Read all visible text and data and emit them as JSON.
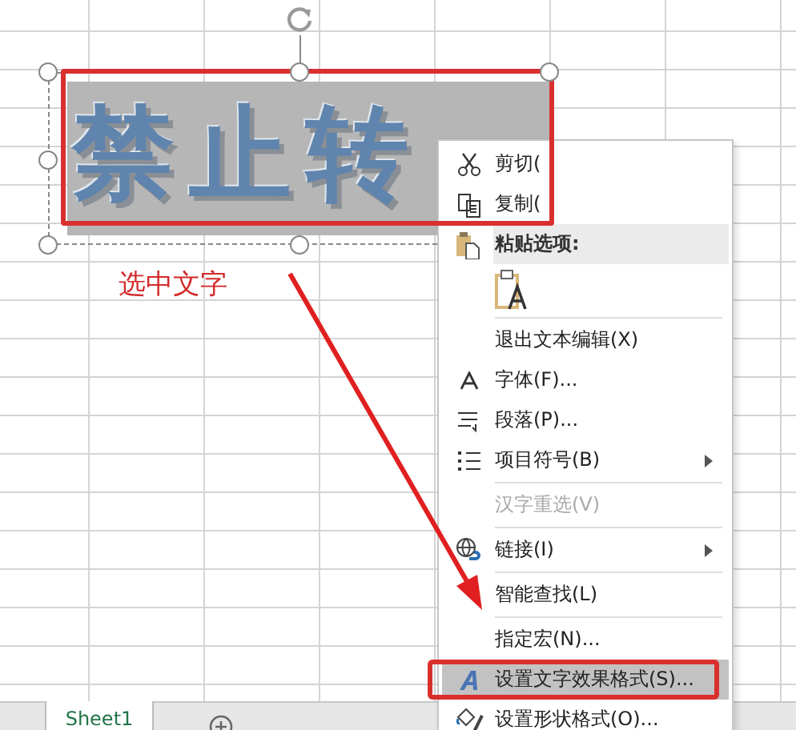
{
  "text_box": {
    "text": "禁止转",
    "selected": true
  },
  "annotation": "选中文字",
  "context_menu": [
    {
      "kind": "item",
      "label": "剪切(",
      "disabled": false,
      "selected": false,
      "submenu": false
    },
    {
      "kind": "item",
      "label": "复制(",
      "disabled": false,
      "selected": false,
      "submenu": false
    },
    {
      "kind": "header",
      "label": "粘贴选项:"
    },
    {
      "kind": "paste"
    },
    {
      "kind": "separator"
    },
    {
      "kind": "item",
      "label": "退出文本编辑(X)",
      "disabled": false,
      "selected": false,
      "submenu": false
    },
    {
      "kind": "item",
      "label": "字体(F)...",
      "disabled": false,
      "selected": false,
      "submenu": false
    },
    {
      "kind": "item",
      "label": "段落(P)...",
      "disabled": false,
      "selected": false,
      "submenu": false
    },
    {
      "kind": "item",
      "label": "项目符号(B)",
      "disabled": false,
      "selected": false,
      "submenu": true
    },
    {
      "kind": "separator"
    },
    {
      "kind": "item",
      "label": "汉字重选(V)",
      "disabled": true,
      "selected": false,
      "submenu": false
    },
    {
      "kind": "separator"
    },
    {
      "kind": "item",
      "label": "链接(I)",
      "disabled": false,
      "selected": false,
      "submenu": true
    },
    {
      "kind": "separator"
    },
    {
      "kind": "item",
      "label": "智能查找(L)",
      "disabled": false,
      "selected": false,
      "submenu": false
    },
    {
      "kind": "separator"
    },
    {
      "kind": "item",
      "label": "指定宏(N)...",
      "disabled": false,
      "selected": false,
      "submenu": false
    },
    {
      "kind": "item",
      "label": "设置文字效果格式(S)...",
      "disabled": false,
      "selected": true,
      "submenu": false
    },
    {
      "kind": "item",
      "label": "设置形状格式(O)...",
      "disabled": false,
      "selected": false,
      "submenu": false
    }
  ],
  "sheet_tabs": [
    {
      "label": "Sheet1",
      "selected": true
    }
  ]
}
